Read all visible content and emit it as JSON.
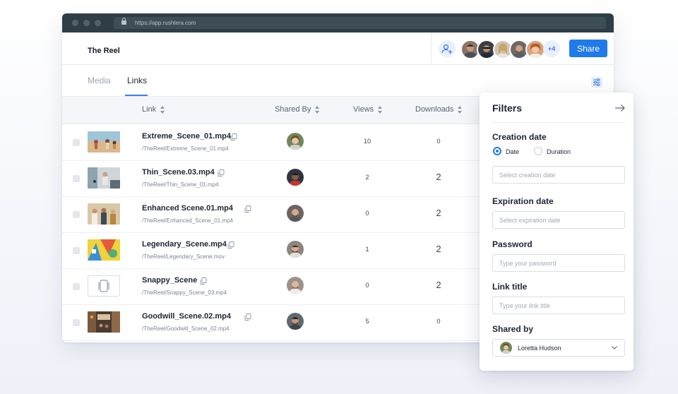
{
  "browser": {
    "url": "https://app.rushtera.com"
  },
  "header": {
    "title": "The Reel",
    "extra_collaborators": "+4",
    "share_label": "Share"
  },
  "tabs": [
    {
      "label": "Media",
      "active": false
    },
    {
      "label": "Links",
      "active": true
    }
  ],
  "table": {
    "columns": [
      "Link",
      "Shared By",
      "Views",
      "Downloads"
    ],
    "rows": [
      {
        "name": "Extreme_Scene_01.mp4",
        "path": "/TheReel/Extreme_Scene_01.mp4",
        "views": "10",
        "downloads": "0"
      },
      {
        "name": "Thin_Scene.03.mp4",
        "path": "/TheReel/Thin_Scene_01.mp4",
        "views": "2",
        "downloads": "2"
      },
      {
        "name": "Enhanced Scene.01.mp4",
        "path": "/TheReel/Enhanced_Scene_01.mp4",
        "views": "0",
        "downloads": "2"
      },
      {
        "name": "Legendary_Scene.mp4",
        "path": "/TheReel/Legendary_Scene.mov",
        "views": "1",
        "downloads": "2"
      },
      {
        "name": "Snappy_Scene",
        "path": "/TheReel/Snappy_Scene_03.mp4",
        "views": "0",
        "downloads": "2"
      },
      {
        "name": "Goodwill_Scene.02.mp4",
        "path": "/TheReel/Goodwill_Scene_02.mp4",
        "views": "5",
        "downloads": "0"
      }
    ]
  },
  "filters": {
    "title": "Filters",
    "creation_date": {
      "label": "Creation date",
      "options": [
        "Date",
        "Duration"
      ],
      "selected": "Date",
      "placeholder": "Select creation date"
    },
    "expiration_date": {
      "label": "Expiration date",
      "placeholder": "Select expiration date"
    },
    "password": {
      "label": "Password",
      "placeholder": "Type your password"
    },
    "link_title": {
      "label": "Link title",
      "placeholder": "Type your link title"
    },
    "shared_by": {
      "label": "Shared by",
      "value": "Loretta Hudson"
    }
  },
  "colors": {
    "accent": "#1f7aea",
    "titlebar": "#2f3e46",
    "table_header_bg": "#f4f6f9"
  }
}
